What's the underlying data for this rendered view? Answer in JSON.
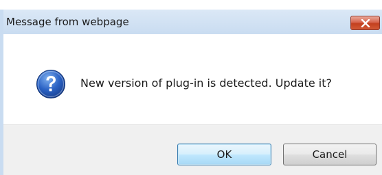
{
  "window": {
    "title": "Message from webpage"
  },
  "icons": {
    "close": "close-icon",
    "question": "question-icon"
  },
  "message": {
    "text": "New version of plug-in is detected. Update it?"
  },
  "buttons": {
    "ok_label": "OK",
    "cancel_label": "Cancel"
  },
  "colors": {
    "titlebar": "#c9dcf1",
    "close_button": "#c2401f",
    "ok_border": "#3c7fb1",
    "icon_blue": "#1f4fa8",
    "footer": "#f0f0f0"
  }
}
